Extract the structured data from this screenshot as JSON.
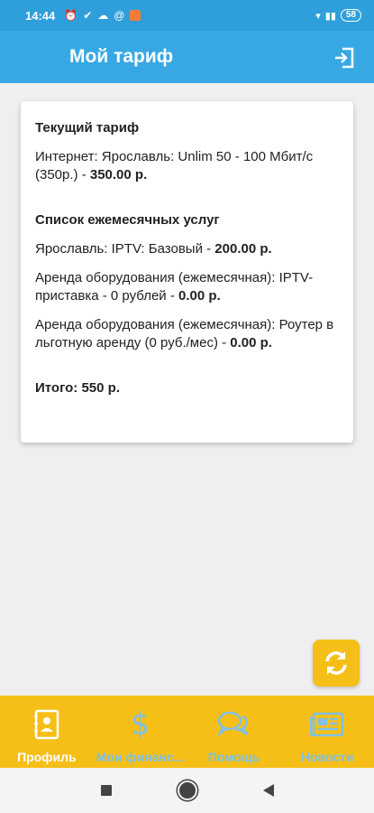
{
  "status_bar": {
    "time": "14:44",
    "battery": "58"
  },
  "header": {
    "title": "Мой тариф"
  },
  "card": {
    "current_tariff_title": "Текущий тариф",
    "tariff_text": "Интернет: Ярославль: Unlim 50 - 100 Мбит/с (350р.) - ",
    "tariff_price": "350.00 р.",
    "services_title": "Список ежемесячных услуг",
    "services": [
      {
        "text": "Ярославль: IPTV: Базовый - ",
        "price": "200.00 р."
      },
      {
        "text": "Аренда оборудования (ежемесячная): IPTV-приставка - 0 рублей  - ",
        "price": "0.00 р."
      },
      {
        "text": "Аренда оборудования (ежемесячная): Роутер в льготную аренду (0 руб./мес) - ",
        "price": "0.00 р."
      }
    ],
    "total": "Итого: 550 р."
  },
  "bottom_nav": {
    "items": [
      {
        "label": "Профиль",
        "icon": "profile-icon"
      },
      {
        "label": "Мои финанс...",
        "icon": "dollar-icon"
      },
      {
        "label": "Помощь",
        "icon": "chat-icon"
      },
      {
        "label": "Новости",
        "icon": "newspaper-icon"
      }
    ]
  },
  "colors": {
    "header": "#38a8e4",
    "accent": "#f6bf17",
    "nav_inactive": "#7ec1e8"
  }
}
